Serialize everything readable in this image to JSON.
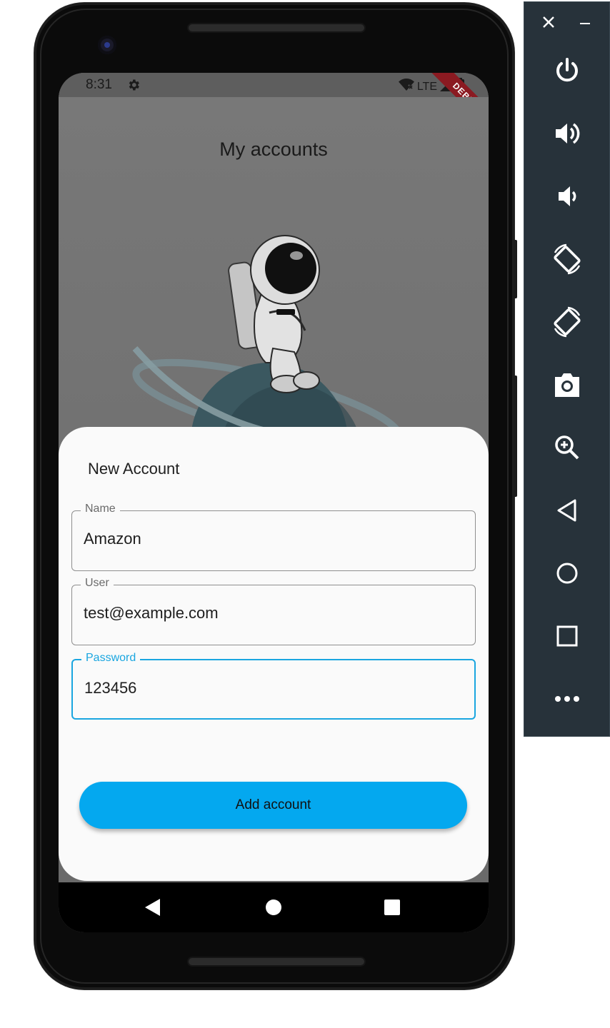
{
  "status_bar": {
    "time": "8:31",
    "network": "LTE",
    "debug_label": "DEBUG"
  },
  "app": {
    "title": "My accounts"
  },
  "sheet": {
    "title": "New Account",
    "fields": [
      {
        "label": "Name",
        "value": "Amazon",
        "focused": false
      },
      {
        "label": "User",
        "value": "test@example.com",
        "focused": false
      },
      {
        "label": "Password",
        "value": "123456",
        "focused": true
      }
    ],
    "button_label": "Add account"
  },
  "nav": [
    "back-icon",
    "home-icon",
    "recents-icon"
  ],
  "emulator_toolbar": [
    "close-icon",
    "minimize-icon",
    "power-icon",
    "volume-up-icon",
    "volume-down-icon",
    "rotate-left-icon",
    "rotate-right-icon",
    "camera-icon",
    "zoom-icon",
    "back-icon",
    "home-icon",
    "overview-icon",
    "more-icon"
  ],
  "colors": {
    "accent": "#04a8ef",
    "focus": "#1aa6e0",
    "debug": "#8e1b22",
    "toolbar": "#27323a"
  }
}
